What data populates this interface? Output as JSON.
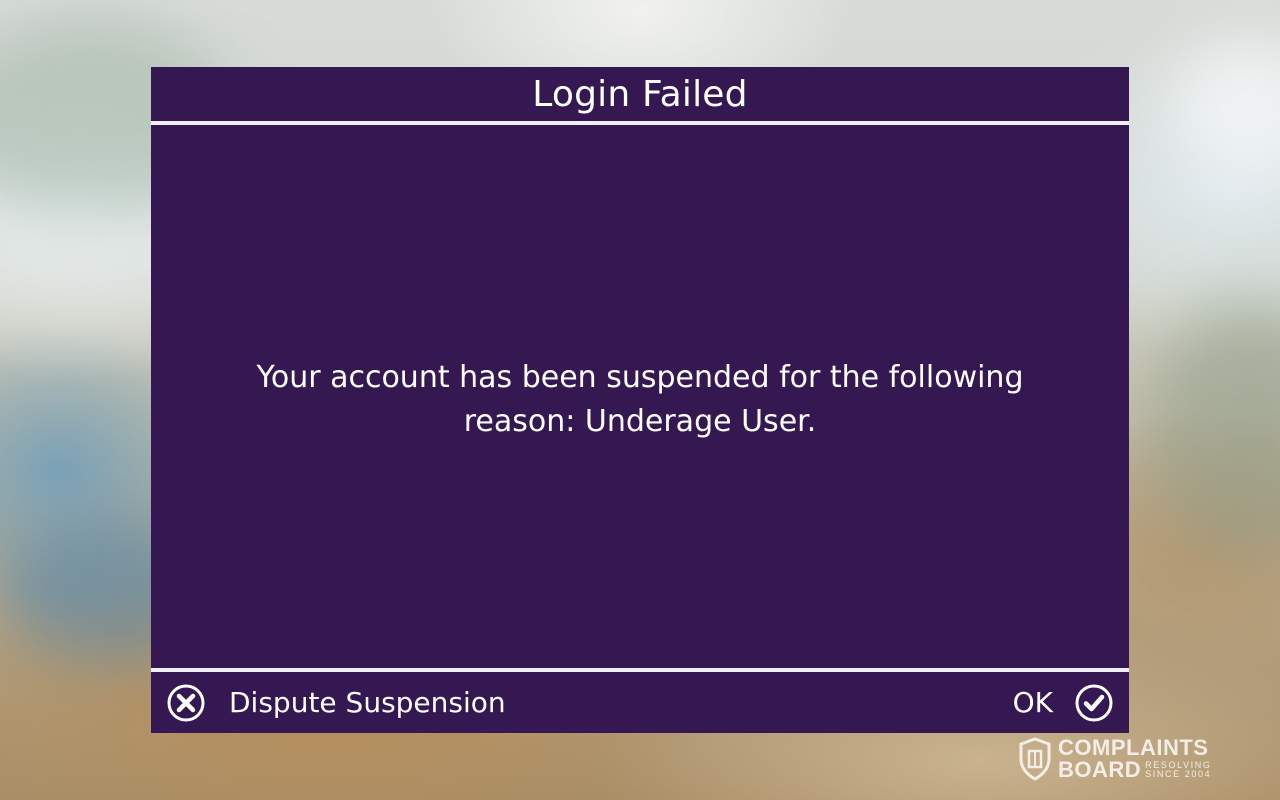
{
  "dialog": {
    "title": "Login Failed",
    "message": "Your account has been suspended for the following reason: Underage User.",
    "background_color": "#351851",
    "buttons": {
      "dispute": {
        "label": "Dispute Suspension",
        "icon": "close-circle-icon"
      },
      "ok": {
        "label": "OK",
        "icon": "check-circle-icon"
      }
    }
  },
  "watermark": {
    "line1": "COMPLAINTS",
    "line2": "BOARD",
    "tagline1": "RESOLVING",
    "tagline2": "SINCE 2004",
    "icon": "shield-icon"
  }
}
